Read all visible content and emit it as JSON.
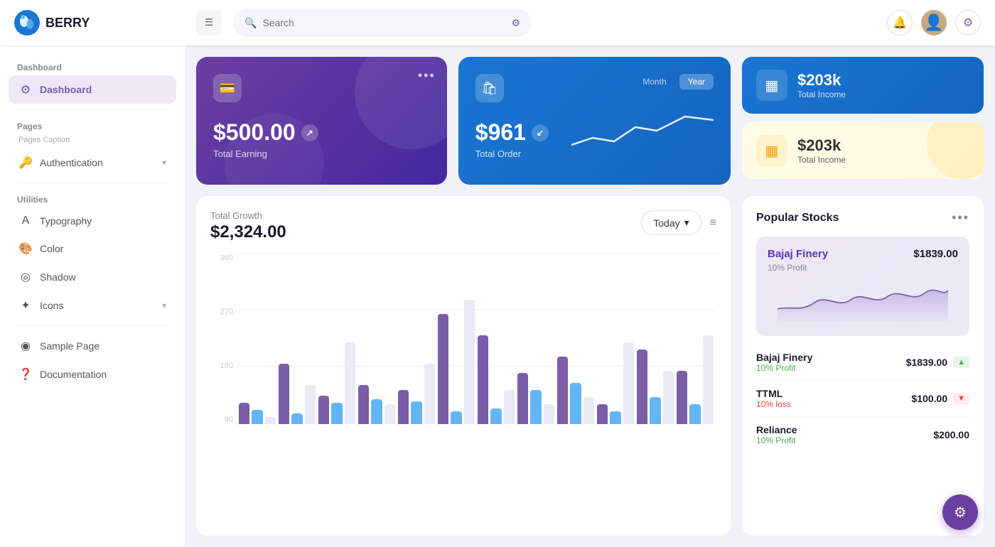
{
  "header": {
    "logo_text": "BERRY",
    "search_placeholder": "Search",
    "menu_icon": "☰"
  },
  "sidebar": {
    "section_dashboard": "Dashboard",
    "item_dashboard": "Dashboard",
    "section_pages": "Pages",
    "pages_caption": "Pages Caption",
    "item_authentication": "Authentication",
    "section_utilities": "Utilities",
    "item_typography": "Typography",
    "item_color": "Color",
    "item_shadow": "Shadow",
    "item_icons": "Icons",
    "item_sample_page": "Sample Page",
    "item_documentation": "Documentation"
  },
  "cards": {
    "earning_amount": "$500.00",
    "earning_label": "Total Earning",
    "order_amount": "$961",
    "order_label": "Total Order",
    "month_label": "Month",
    "year_label": "Year",
    "total_income_amount1": "$203k",
    "total_income_label1": "Total Income",
    "total_income_amount2": "$203k",
    "total_income_label2": "Total Income"
  },
  "chart": {
    "title": "Total Growth",
    "amount": "$2,324.00",
    "today_label": "Today",
    "menu_icon": "≡",
    "y_labels": [
      "360",
      "270",
      "180",
      "90"
    ],
    "bars": [
      {
        "purple": 30,
        "blue": 20,
        "light": 10
      },
      {
        "purple": 90,
        "blue": 15,
        "light": 60
      },
      {
        "purple": 40,
        "blue": 30,
        "light": 120
      },
      {
        "purple": 60,
        "blue": 40,
        "light": 30
      },
      {
        "purple": 50,
        "blue": 35,
        "light": 90
      },
      {
        "purple": 160,
        "blue": 20,
        "light": 180
      },
      {
        "purple": 130,
        "blue": 25,
        "light": 50
      },
      {
        "purple": 75,
        "blue": 50,
        "light": 30
      },
      {
        "purple": 100,
        "blue": 60,
        "light": 40
      },
      {
        "purple": 30,
        "blue": 20,
        "light": 120
      },
      {
        "purple": 110,
        "blue": 40,
        "light": 80
      },
      {
        "purple": 80,
        "blue": 30,
        "light": 130
      }
    ]
  },
  "stocks": {
    "title": "Popular Stocks",
    "featured_name": "Bajaj Finery",
    "featured_price": "$1839.00",
    "featured_profit": "10% Profit",
    "rows": [
      {
        "name": "Bajaj Finery",
        "price": "$1839.00",
        "change": "10% Profit",
        "trend": "up"
      },
      {
        "name": "TTML",
        "price": "$100.00",
        "change": "10% loss",
        "trend": "down"
      },
      {
        "name": "Reliance",
        "price": "$200.00",
        "change": "10% Profit",
        "trend": "up"
      }
    ]
  },
  "fab": {
    "icon": "⚙"
  }
}
